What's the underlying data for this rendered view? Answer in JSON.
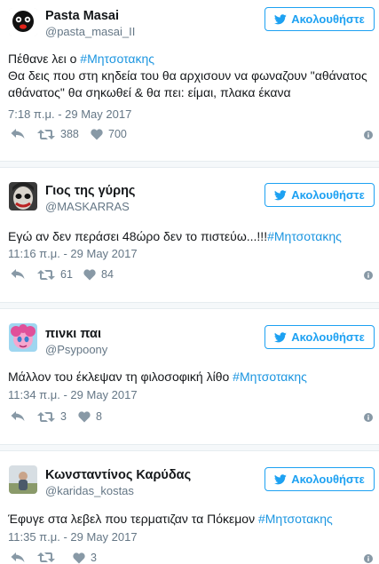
{
  "follow_label": "Ακολουθήστε",
  "tweets": [
    {
      "name": "Pasta Masai",
      "handle": "@pasta_masai_II",
      "text_line1": "Πέθανε λει ο ",
      "text_line1_tag": "#Μητσοτακης",
      "text_line2": "Θα δεις που στη κηδεία του θα αρχισουν να φωναζουν \"αθάνατος αθάνατος\" θα σηκωθεί & θα πει: είμαι, πλακα έκανα",
      "time": "7:18 π.μ. - 29 May 2017",
      "retweets": "388",
      "likes": "700"
    },
    {
      "name": "Γιος της γύρης",
      "handle": "@MASKARRAS",
      "text": "Εγώ αν δεν περάσει 48ώρο δεν το πιστεύω...!!!",
      "tag": "#Μητσοτακης",
      "time": "11:16 π.μ. - 29 May 2017",
      "retweets": "61",
      "likes": "84"
    },
    {
      "name": "πινκι παι",
      "handle": "@Psypoony",
      "text": "Μάλλον του έκλεψαν τη φιλοσοφική λίθο ",
      "tag": "#Μητσοτακης",
      "time": "11:34 π.μ. - 29 May 2017",
      "retweets": "3",
      "likes": "8"
    },
    {
      "name": "Κωνσταντίνος Καρύδας",
      "handle": "@karidas_kostas",
      "text": "Έφυγε στα λεβελ που τερματιζαν τα Πόκεμον ",
      "tag": "#Μητσοτακης",
      "time": "11:35 π.μ. - 29 May 2017",
      "retweets": "",
      "likes": "3"
    }
  ],
  "colors": {
    "accent": "#1da1f2",
    "hashtag": "#1b95e0",
    "muted": "#657786"
  },
  "icons": [
    "twitter-bird-icon",
    "reply-icon",
    "retweet-icon",
    "heart-icon",
    "info-icon"
  ]
}
